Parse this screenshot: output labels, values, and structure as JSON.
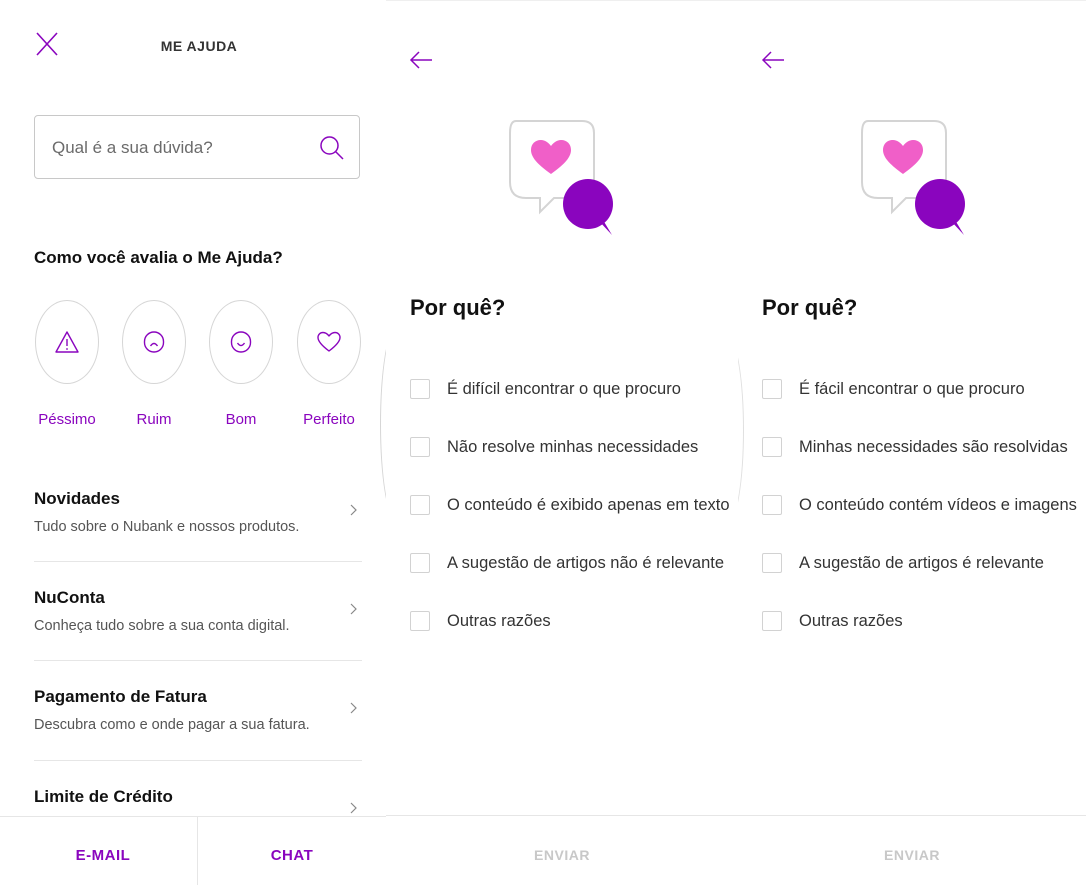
{
  "help": {
    "title": "ME AJUDA",
    "search_placeholder": "Qual é a sua dúvida?",
    "rating_heading": "Como você avalia o Me Ajuda?",
    "ratings": [
      {
        "label": "Péssimo",
        "icon": "warning-icon"
      },
      {
        "label": "Ruim",
        "icon": "sad-face-icon"
      },
      {
        "label": "Bom",
        "icon": "smile-face-icon"
      },
      {
        "label": "Perfeito",
        "icon": "heart-icon"
      }
    ],
    "menu": [
      {
        "title": "Novidades",
        "subtitle": "Tudo sobre o Nubank e nossos produtos."
      },
      {
        "title": "NuConta",
        "subtitle": "Conheça tudo sobre a sua conta digital."
      },
      {
        "title": "Pagamento de Fatura",
        "subtitle": "Descubra como e onde pagar a sua fatura."
      },
      {
        "title": "Limite de Crédito",
        "subtitle": ""
      }
    ],
    "bottom": {
      "email": "E-MAIL",
      "chat": "CHAT"
    }
  },
  "feedback_negative": {
    "heading": "Por quê?",
    "options": [
      "É difícil encontrar o que procuro",
      "Não resolve minhas necessidades",
      "O conteúdo é exibido apenas em texto",
      "A sugestão de artigos não é relevante",
      "Outras razões"
    ],
    "send": "ENVIAR"
  },
  "feedback_positive": {
    "heading": "Por quê?",
    "options": [
      "É fácil encontrar o que procuro",
      "Minhas necessidades são resolvidas",
      "O conteúdo contém vídeos e imagens",
      "A sugestão de artigos é relevante",
      "Outras razões"
    ],
    "send": "ENVIAR"
  },
  "colors": {
    "accent": "#8a05be",
    "heart": "#f05fc8",
    "disabled": "#c8c8c8"
  }
}
